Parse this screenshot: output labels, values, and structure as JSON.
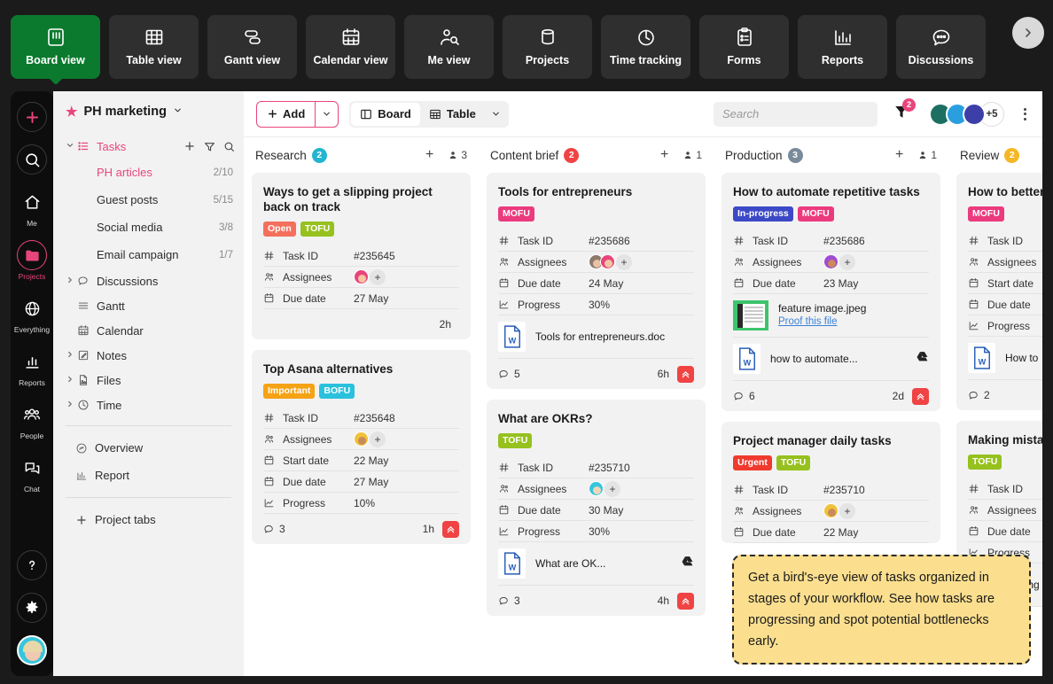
{
  "topnav": {
    "items": [
      {
        "label": "Board view",
        "icon": "board-view-icon",
        "active": true
      },
      {
        "label": "Table view",
        "icon": "table-view-icon",
        "active": false
      },
      {
        "label": "Gantt view",
        "icon": "gantt-view-icon",
        "active": false
      },
      {
        "label": "Calendar view",
        "icon": "calendar-view-icon",
        "active": false
      },
      {
        "label": "Me view",
        "icon": "me-view-icon",
        "active": false
      },
      {
        "label": "Projects",
        "icon": "projects-icon",
        "active": false
      },
      {
        "label": "Time tracking",
        "icon": "time-tracking-icon",
        "active": false
      },
      {
        "label": "Forms",
        "icon": "forms-icon",
        "active": false
      },
      {
        "label": "Reports",
        "icon": "reports-icon",
        "active": false
      },
      {
        "label": "Discussions",
        "icon": "discussions-icon",
        "active": false
      }
    ],
    "next_arrow": "chevron-right-icon"
  },
  "rail": {
    "items": [
      {
        "label": "",
        "icon": "plus-icon"
      },
      {
        "label": "",
        "icon": "search-icon"
      },
      {
        "label": "Me",
        "icon": "home-icon"
      },
      {
        "label": "Projects",
        "icon": "folder-icon",
        "active": true
      },
      {
        "label": "Everything",
        "icon": "globe-icon"
      },
      {
        "label": "Reports",
        "icon": "chart-icon"
      },
      {
        "label": "People",
        "icon": "people-icon"
      },
      {
        "label": "Chat",
        "icon": "chat-icon"
      }
    ],
    "bottom": [
      {
        "label": "",
        "icon": "help-icon"
      },
      {
        "label": "",
        "icon": "gear-icon"
      }
    ],
    "avatar": "user-avatar"
  },
  "sidebar": {
    "project_title": "PH marketing",
    "project_caret": "chevron-down-icon",
    "tasks_section": {
      "label": "Tasks",
      "actions": [
        "plus-icon",
        "filter-icon",
        "search-icon"
      ],
      "items": [
        {
          "label": "PH articles",
          "count": "2/10",
          "selected": true
        },
        {
          "label": "Guest posts",
          "count": "5/15",
          "selected": false
        },
        {
          "label": "Social media",
          "count": "3/8",
          "selected": false
        },
        {
          "label": "Email campaign",
          "count": "1/7",
          "selected": false
        }
      ]
    },
    "sections": [
      {
        "label": "Discussions",
        "icon": "chat-icon",
        "expandable": true
      },
      {
        "label": "Gantt",
        "icon": "gantt-icon",
        "expandable": false
      },
      {
        "label": "Calendar",
        "icon": "calendar-icon",
        "expandable": false
      },
      {
        "label": "Notes",
        "icon": "notes-icon",
        "expandable": true
      },
      {
        "label": "Files",
        "icon": "file-icon",
        "expandable": true
      },
      {
        "label": "Time",
        "icon": "clock-icon",
        "expandable": true
      }
    ],
    "extras": [
      {
        "label": "Overview",
        "icon": "overview-icon"
      },
      {
        "label": "Report",
        "icon": "report-icon"
      }
    ],
    "add_tab": {
      "label": "Project tabs",
      "icon": "plus-icon"
    }
  },
  "toolbar": {
    "add_label": "Add",
    "add_caret": "chevron-down-icon",
    "views": [
      {
        "label": "Board",
        "icon": "board-icon",
        "active": true
      },
      {
        "label": "Table",
        "icon": "table-icon",
        "active": false
      }
    ],
    "view_caret": "chevron-down-icon",
    "search_placeholder": "Search",
    "filter_icon": "filter-icon",
    "filter_count": "2",
    "avatars_more": "+5",
    "kebab": "more-options-icon"
  },
  "colors": {
    "accent_pink": "#e8457c",
    "active_green": "#0b7a2e",
    "research_badge": "#23b5cf",
    "content_brief_badge": "#f04343",
    "production_badge": "#7a8b9a",
    "review_badge": "#f5b723"
  },
  "board": {
    "columns": [
      {
        "title": "Research",
        "count": "2",
        "count_color": "#23b5cf",
        "people": "3",
        "cards": [
          {
            "title": "Ways to get a slipping project back on track",
            "tags": [
              {
                "label": "Open",
                "color": "#f4705c"
              },
              {
                "label": "TOFU",
                "color": "#96c11e"
              }
            ],
            "fields": [
              {
                "icon": "hash-icon",
                "label": "Task ID",
                "value": "#235645"
              },
              {
                "icon": "assignees-icon",
                "label": "Assignees",
                "value": "",
                "assignees": [
                  "pink-haired-woman"
                ]
              },
              {
                "icon": "calendar-icon",
                "label": "Due date",
                "value": "27 May"
              }
            ],
            "attachments": [],
            "footer": {
              "comments": "",
              "time": "2h",
              "priority": false
            }
          },
          {
            "title": "Top Asana alternatives",
            "tags": [
              {
                "label": "Important",
                "color": "#f5a214"
              },
              {
                "label": "BOFU",
                "color": "#2ac1dd"
              }
            ],
            "fields": [
              {
                "icon": "hash-icon",
                "label": "Task ID",
                "value": "#235648"
              },
              {
                "icon": "assignees-icon",
                "label": "Assignees",
                "value": "",
                "assignees": [
                  "bearded-man"
                ]
              },
              {
                "icon": "calendar-icon",
                "label": "Start date",
                "value": "22 May"
              },
              {
                "icon": "calendar-icon",
                "label": "Due date",
                "value": "27 May"
              },
              {
                "icon": "progress-icon",
                "label": "Progress",
                "value": "10%"
              }
            ],
            "attachments": [],
            "footer": {
              "comments": "3",
              "time": "1h",
              "priority": true
            }
          }
        ]
      },
      {
        "title": "Content brief",
        "count": "2",
        "count_color": "#f04343",
        "people": "1",
        "cards": [
          {
            "title": "Tools for entrepreneurs",
            "tags": [
              {
                "label": "MOFU",
                "color": "#eb3a7e"
              }
            ],
            "fields": [
              {
                "icon": "hash-icon",
                "label": "Task ID",
                "value": "#235686"
              },
              {
                "icon": "assignees-icon",
                "label": "Assignees",
                "value": "",
                "assignees": [
                  "older-man",
                  "pink-haired-woman"
                ]
              },
              {
                "icon": "calendar-icon",
                "label": "Due date",
                "value": "24 May"
              },
              {
                "icon": "progress-icon",
                "label": "Progress",
                "value": "30%"
              }
            ],
            "attachments": [
              {
                "type": "word",
                "name": "Tools for entrepreneurs.doc",
                "link": "",
                "drive": false
              }
            ],
            "footer": {
              "comments": "5",
              "time": "6h",
              "priority": true
            }
          },
          {
            "title": "What are OKRs?",
            "tags": [
              {
                "label": "TOFU",
                "color": "#96c11e"
              }
            ],
            "fields": [
              {
                "icon": "hash-icon",
                "label": "Task ID",
                "value": "#235710"
              },
              {
                "icon": "assignees-icon",
                "label": "Assignees",
                "value": "",
                "assignees": [
                  "blonde-woman"
                ]
              },
              {
                "icon": "calendar-icon",
                "label": "Due date",
                "value": "30 May"
              },
              {
                "icon": "progress-icon",
                "label": "Progress",
                "value": "30%"
              }
            ],
            "attachments": [
              {
                "type": "word",
                "name": "What are OK...",
                "link": "",
                "drive": true
              }
            ],
            "footer": {
              "comments": "3",
              "time": "4h",
              "priority": true
            }
          }
        ]
      },
      {
        "title": "Production",
        "count": "3",
        "count_color": "#7a8b9a",
        "people": "1",
        "cards": [
          {
            "title": "How to automate repetitive tasks",
            "tags": [
              {
                "label": "In-progress",
                "color": "#3b49c7"
              },
              {
                "label": "MOFU",
                "color": "#eb3a7e"
              }
            ],
            "fields": [
              {
                "icon": "hash-icon",
                "label": "Task ID",
                "value": "#235686"
              },
              {
                "icon": "assignees-icon",
                "label": "Assignees",
                "value": "",
                "assignees": [
                  "purple-bg-man"
                ]
              },
              {
                "icon": "calendar-icon",
                "label": "Due date",
                "value": "23 May"
              }
            ],
            "attachments": [
              {
                "type": "image",
                "name": "feature image.jpeg",
                "link": "Proof this file",
                "drive": false
              },
              {
                "type": "word",
                "name": "how to automate...",
                "link": "",
                "drive": true
              }
            ],
            "footer": {
              "comments": "6",
              "time": "2d",
              "priority": true
            }
          },
          {
            "title": "Project manager daily tasks",
            "tags": [
              {
                "label": "Urgent",
                "color": "#f03a2e"
              },
              {
                "label": "TOFU",
                "color": "#96c11e"
              }
            ],
            "fields": [
              {
                "icon": "hash-icon",
                "label": "Task ID",
                "value": "#235710"
              },
              {
                "icon": "assignees-icon",
                "label": "Assignees",
                "value": "",
                "assignees": [
                  "bearded-man"
                ]
              },
              {
                "icon": "calendar-icon",
                "label": "Due date",
                "value": "22 May"
              }
            ],
            "attachments": [],
            "footer": {
              "comments": "",
              "time": "",
              "priority": false
            }
          }
        ]
      },
      {
        "title": "Review",
        "count": "2",
        "count_color": "#f5b723",
        "people": "",
        "cards": [
          {
            "title": "How to better h deadlines as a",
            "tags": [
              {
                "label": "MOFU",
                "color": "#eb3a7e"
              }
            ],
            "fields": [
              {
                "icon": "hash-icon",
                "label": "Task ID",
                "value": ""
              },
              {
                "icon": "assignees-icon",
                "label": "Assignees",
                "value": ""
              },
              {
                "icon": "calendar-icon",
                "label": "Start date",
                "value": ""
              },
              {
                "icon": "calendar-icon",
                "label": "Due date",
                "value": ""
              },
              {
                "icon": "progress-icon",
                "label": "Progress",
                "value": ""
              }
            ],
            "attachments": [
              {
                "type": "word",
                "name": "How to",
                "link": "",
                "drive": false
              }
            ],
            "footer": {
              "comments": "2",
              "time": "",
              "priority": false
            }
          },
          {
            "title": "Making mistak",
            "tags": [
              {
                "label": "TOFU",
                "color": "#96c11e"
              }
            ],
            "fields": [
              {
                "icon": "hash-icon",
                "label": "Task ID",
                "value": ""
              },
              {
                "icon": "assignees-icon",
                "label": "Assignees",
                "value": ""
              },
              {
                "icon": "calendar-icon",
                "label": "Due date",
                "value": ""
              },
              {
                "icon": "progress-icon",
                "label": "Progress",
                "value": ""
              }
            ],
            "attachments": [
              {
                "type": "word",
                "name": "Making",
                "link": "",
                "drive": false
              }
            ],
            "footer": {
              "comments": "",
              "time": "",
              "priority": false
            }
          }
        ]
      }
    ]
  },
  "tooltip": {
    "text": "Get a bird's-eye view of tasks organized in stages of your workflow. See how tasks are progressing and spot potential bottlenecks early."
  }
}
